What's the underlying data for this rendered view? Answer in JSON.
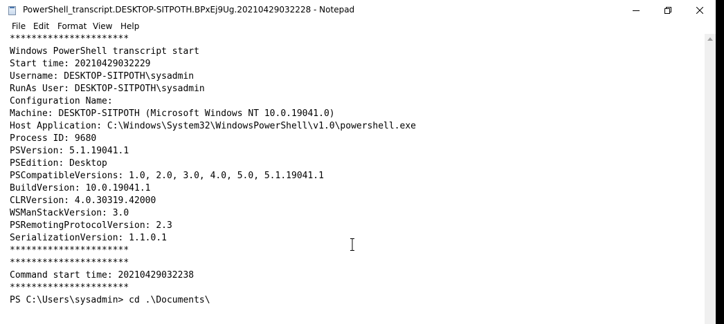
{
  "window": {
    "title": "PowerShell_transcript.DESKTOP-SITPOTH.BPxEj9Ug.20210429032228 - Notepad"
  },
  "menu": {
    "file": "File",
    "edit": "Edit",
    "format": "Format",
    "view": "View",
    "help": "Help"
  },
  "editor": {
    "lines": [
      "**********************",
      "Windows PowerShell transcript start",
      "Start time: 20210429032229",
      "Username: DESKTOP-SITPOTH\\sysadmin",
      "RunAs User: DESKTOP-SITPOTH\\sysadmin",
      "Configuration Name: ",
      "Machine: DESKTOP-SITPOTH (Microsoft Windows NT 10.0.19041.0)",
      "Host Application: C:\\Windows\\System32\\WindowsPowerShell\\v1.0\\powershell.exe",
      "Process ID: 9680",
      "PSVersion: 5.1.19041.1",
      "PSEdition: Desktop",
      "PSCompatibleVersions: 1.0, 2.0, 3.0, 4.0, 5.0, 5.1.19041.1",
      "BuildVersion: 10.0.19041.1",
      "CLRVersion: 4.0.30319.42000",
      "WSManStackVersion: 3.0",
      "PSRemotingProtocolVersion: 2.3",
      "SerializationVersion: 1.1.0.1",
      "**********************",
      "**********************",
      "Command start time: 20210429032238",
      "**********************",
      "PS C:\\Users\\sysadmin> cd .\\Documents\\"
    ]
  },
  "icons": {
    "app": "notepad-icon",
    "minimize": "minimize-icon",
    "maximize": "restore-icon",
    "close": "close-icon"
  }
}
